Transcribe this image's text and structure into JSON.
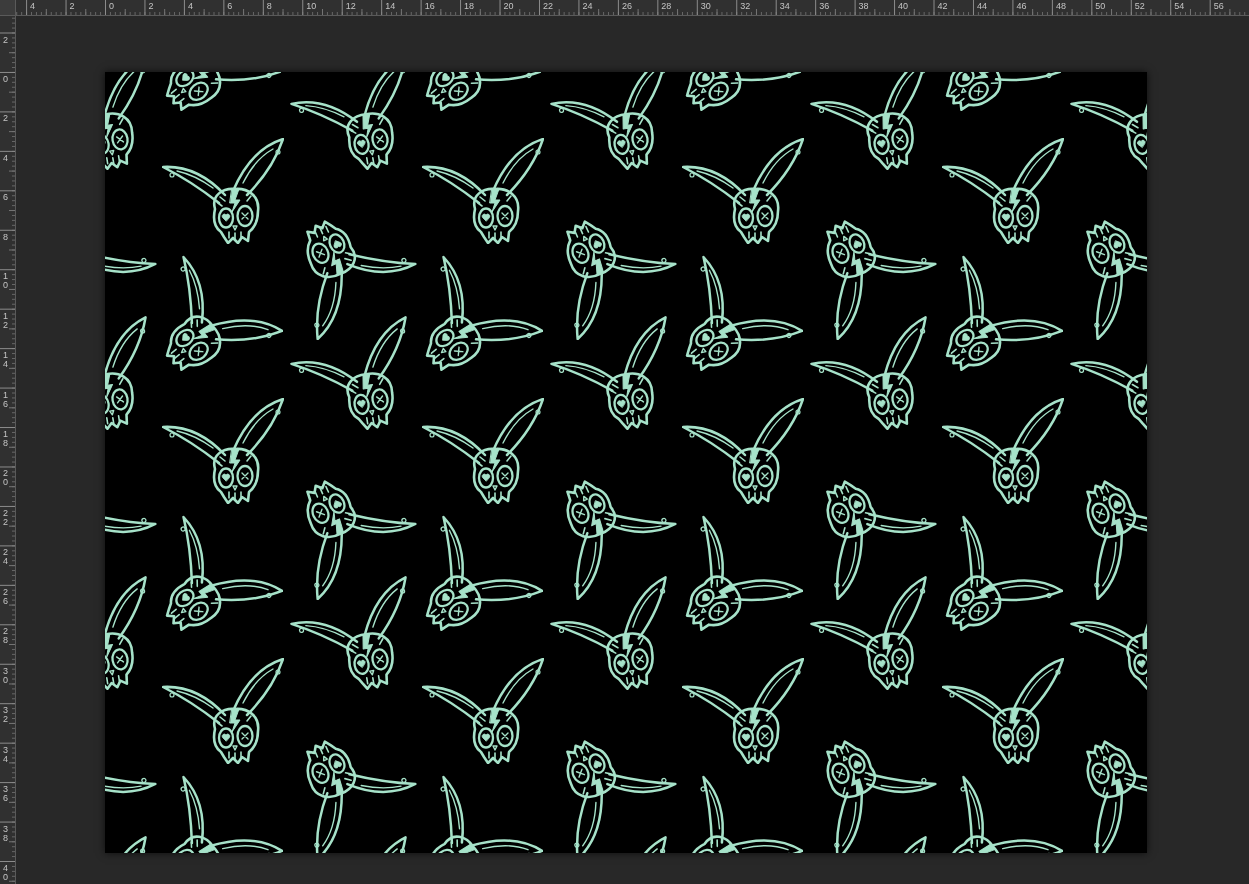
{
  "rulers": {
    "horizontal": {
      "labels": [
        "4",
        "2",
        "0",
        "2",
        "4",
        "6",
        "8",
        "10",
        "12",
        "14",
        "16",
        "18",
        "20",
        "22",
        "24",
        "26",
        "28",
        "30",
        "32",
        "34",
        "36",
        "38",
        "40",
        "42",
        "44",
        "46",
        "48",
        "50",
        "52",
        "54",
        "56"
      ]
    },
    "vertical": {
      "labels": [
        "2",
        "0",
        "2",
        "4",
        "6",
        "8",
        "10",
        "12",
        "14",
        "16",
        "18",
        "20",
        "22",
        "24",
        "26",
        "28",
        "30",
        "32",
        "34",
        "36",
        "38",
        "40"
      ]
    }
  }
}
